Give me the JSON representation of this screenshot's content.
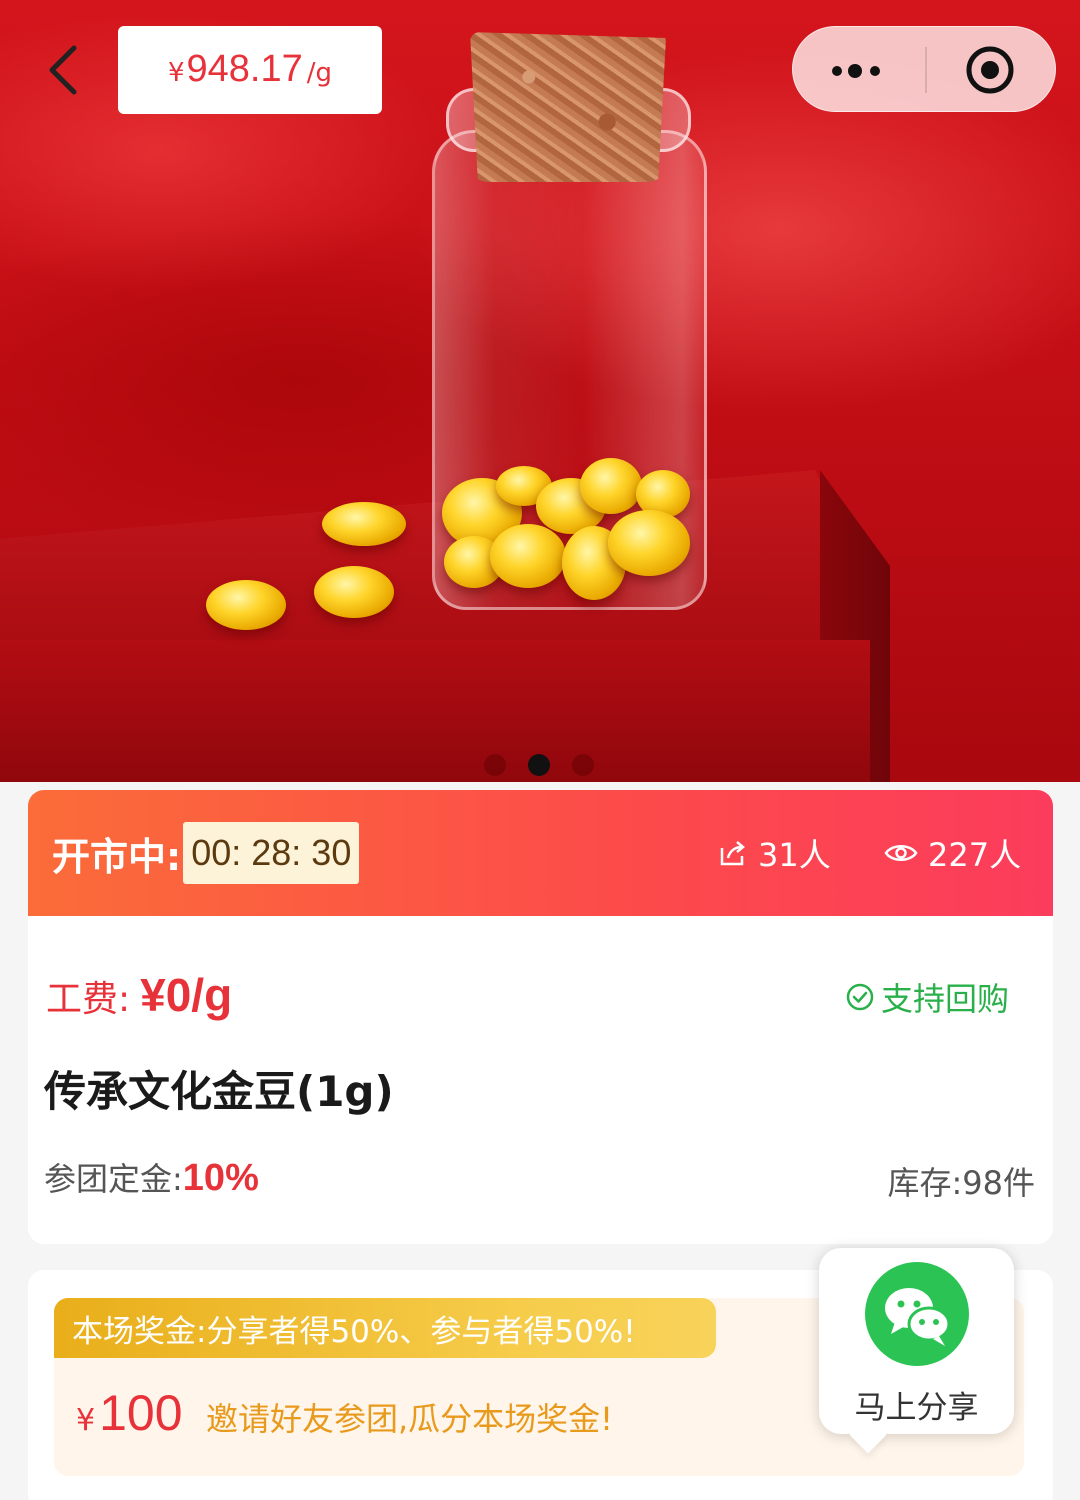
{
  "header": {
    "price_currency": "¥",
    "price_value": "948.17",
    "price_unit": "/g"
  },
  "carousel": {
    "count": 3,
    "active_index": 1
  },
  "market": {
    "status_label": "开市中:",
    "countdown": "00: 28: 30",
    "share_count": "31人",
    "view_count": "227人"
  },
  "product": {
    "fee_label": "工费:",
    "fee_value": "¥0/g",
    "buyback_label": "支持回购",
    "title": "传承文化金豆(1g)",
    "deposit_label": "参团定金:",
    "deposit_value": "10%",
    "stock_label": "库存:98件"
  },
  "bonus": {
    "tag": "本场奖金:分享者得50%、参与者得50%!",
    "currency": "¥",
    "amount": "100",
    "description": "邀请好友参团,瓜分本场奖金!"
  },
  "share": {
    "label": "马上分享"
  },
  "colors": {
    "accent_red": "#e8323a",
    "banner_orange": "#fb6c39",
    "banner_pink": "#fc3c5c",
    "buyback_green": "#29b04a",
    "bonus_gold": "#e9ae1a",
    "wechat_green": "#2bc454"
  }
}
